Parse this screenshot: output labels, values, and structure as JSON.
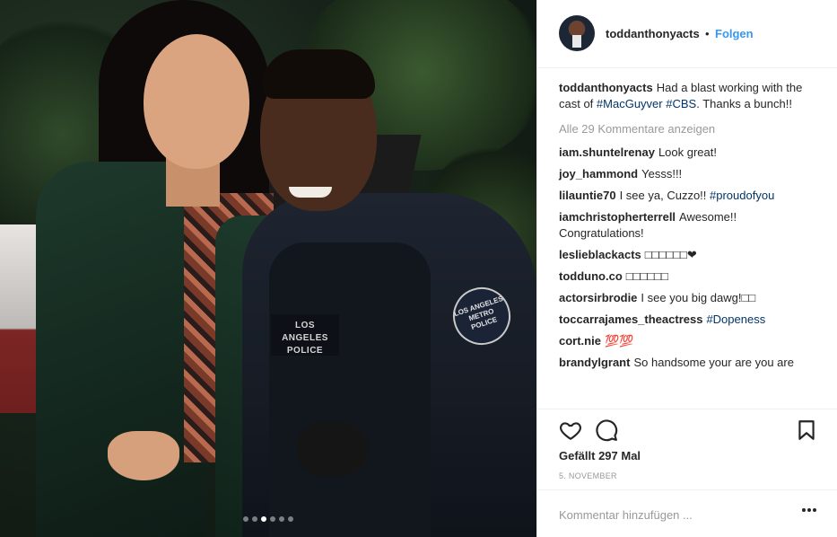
{
  "post": {
    "photo_caption_badge": "LOS ANGELES\nPOLICE",
    "patch_text": "LOS ANGELES METRO POLICE",
    "carousel": {
      "count": 6,
      "active_index": 2
    }
  },
  "header": {
    "username": "toddanthonyacts",
    "separator": "•",
    "follow_label": "Folgen",
    "avatar_icon": "user-avatar"
  },
  "caption": {
    "username": "toddanthonyacts",
    "text_before": "Had a blast working with the cast of ",
    "tags": [
      "#MacGuyver",
      "#CBS"
    ],
    "text_after": ". Thanks a bunch!!"
  },
  "view_all_comments": "Alle 29 Kommentare anzeigen",
  "comments": [
    {
      "user": "iam.shuntelrenay",
      "text": "Look great!"
    },
    {
      "user": "joy_hammond",
      "text": "Yesss!!!"
    },
    {
      "user": "lilauntie70",
      "text": "I see ya, Cuzzo!! ",
      "tag": "#proudofyou"
    },
    {
      "user": "iamchristopherterrell",
      "text": "Awesome!! Congratulations!"
    },
    {
      "user": "leslieblackacts",
      "text": "□□□□□□❤"
    },
    {
      "user": "todduno.co",
      "text": "□□□□□□"
    },
    {
      "user": "actorsirbrodie",
      "text": "I see you big dawg!□□"
    },
    {
      "user": "toccarrajames_theactress",
      "text": "",
      "tag": "#Dopeness"
    },
    {
      "user": "cort.nie",
      "text": "💯💯"
    },
    {
      "user": "brandylgrant",
      "text": "So handsome your are you are"
    }
  ],
  "actions": {
    "like_icon": "heart-icon",
    "comment_icon": "comment-bubble-icon",
    "save_icon": "bookmark-icon",
    "likes_text": "Gefällt 297 Mal",
    "date": "5. NOVEMBER"
  },
  "add_comment": {
    "placeholder": "Kommentar hinzufügen ...",
    "more_icon": "ellipsis-icon"
  },
  "colors": {
    "link": "#3897f0",
    "hashtag": "#003569",
    "muted": "#999999",
    "text": "#262626",
    "border": "#efefef"
  }
}
